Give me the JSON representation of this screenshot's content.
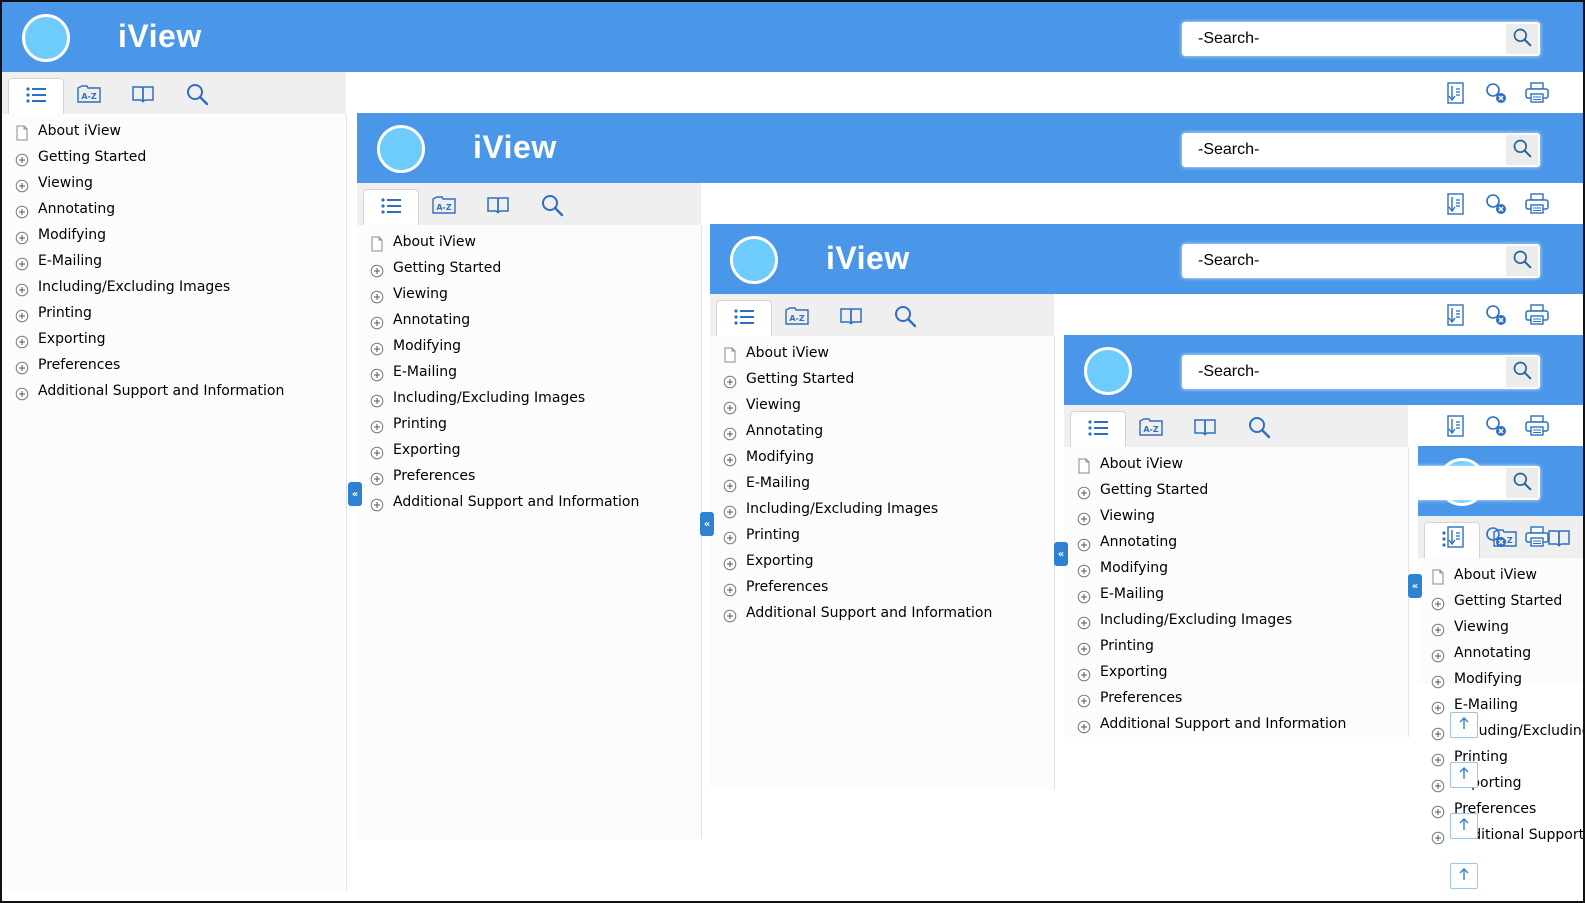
{
  "app": {
    "title": "iView"
  },
  "search": {
    "placeholder": "-Search-"
  },
  "tabs": [
    "contents-icon",
    "index-icon",
    "glossary-icon",
    "search-icon"
  ],
  "toolbar": [
    "expand-all-icon",
    "clear-highlight-icon",
    "print-icon"
  ],
  "toc": {
    "items": [
      {
        "label": "About iView",
        "icon": "page-icon"
      },
      {
        "label": "Getting Started",
        "icon": "plus-icon"
      },
      {
        "label": "Viewing",
        "icon": "plus-icon"
      },
      {
        "label": "Annotating",
        "icon": "plus-icon"
      },
      {
        "label": "Modifying",
        "icon": "plus-icon"
      },
      {
        "label": "E-Mailing",
        "icon": "plus-icon"
      },
      {
        "label": "Including/Excluding Images",
        "icon": "plus-icon"
      },
      {
        "label": "Printing",
        "icon": "plus-icon"
      },
      {
        "label": "Exporting",
        "icon": "plus-icon"
      },
      {
        "label": "Preferences",
        "icon": "plus-icon"
      },
      {
        "label": "Additional Support and Information",
        "icon": "plus-icon"
      }
    ]
  },
  "collapse_label": "«",
  "colors": {
    "header": "#4a96e8",
    "logo": "#6dccfb",
    "accent": "#2e82d4"
  }
}
